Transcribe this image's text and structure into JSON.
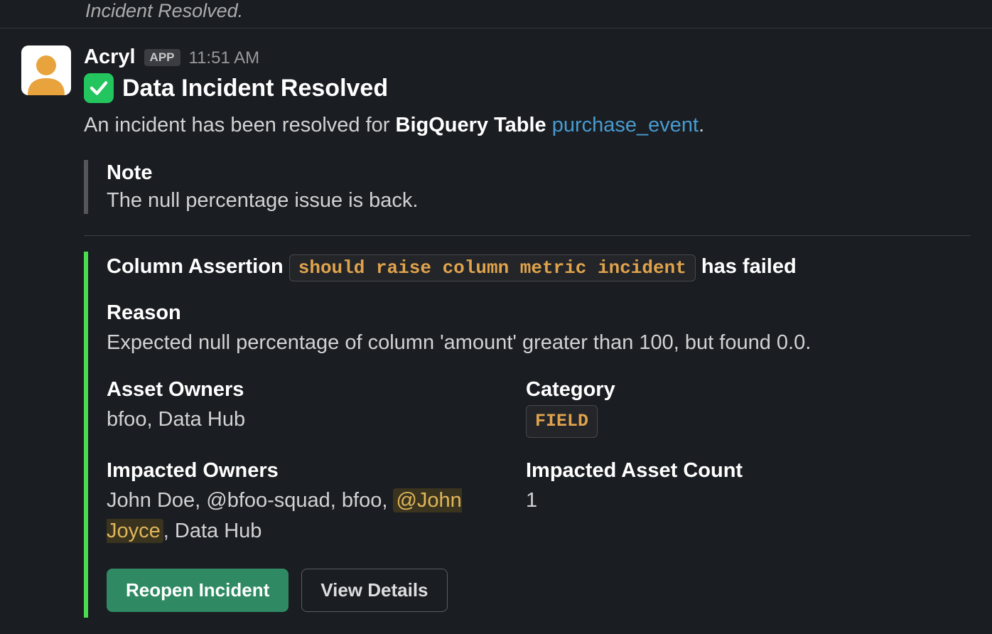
{
  "crumb_text": "Incident Resolved.",
  "message": {
    "sender": "Acryl",
    "app_badge": "APP",
    "timestamp": "11:51 AM",
    "title": "Data Incident Resolved",
    "body_prefix": "An incident has been resolved for ",
    "body_bold": "BigQuery Table ",
    "body_link": "purchase_event",
    "body_suffix": ".",
    "note": {
      "label": "Note",
      "text": "The null percentage issue is back."
    },
    "assertion": {
      "prefix": "Column Assertion ",
      "code": "should raise column metric incident",
      "suffix": " has failed",
      "reason_label": "Reason",
      "reason_text": "Expected null percentage of column 'amount' greater than 100, but found 0.0.",
      "asset_owners_label": "Asset Owners",
      "asset_owners_value": "bfoo, Data Hub",
      "category_label": "Category",
      "category_value": "FIELD",
      "impacted_owners_label": "Impacted Owners",
      "impacted_owners_prefix": "John Doe, @bfoo-squad, bfoo, ",
      "impacted_owners_mention": "@John Joyce",
      "impacted_owners_suffix": ", Data Hub",
      "impacted_count_label": "Impacted Asset Count",
      "impacted_count_value": "1"
    },
    "buttons": {
      "reopen": "Reopen Incident",
      "view": "View Details"
    }
  }
}
